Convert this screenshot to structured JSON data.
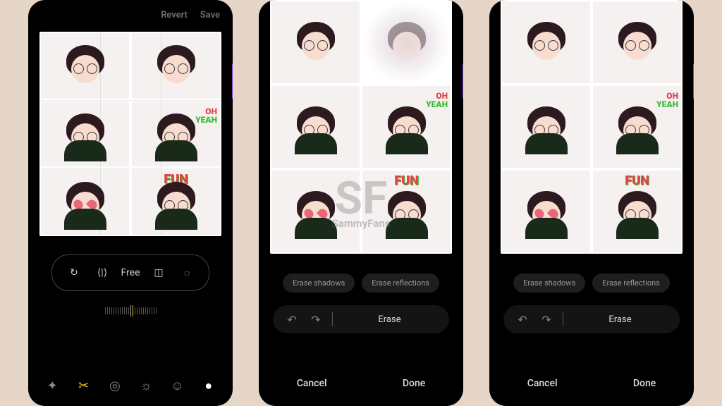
{
  "phone1": {
    "topbar": {
      "revert": "Revert",
      "save": "Save"
    },
    "crop_tools": {
      "rotate": "↻",
      "flip_h": "⟨|⟩",
      "free": "Free",
      "perspective": "◫",
      "shape": "◌"
    },
    "bottom_nav": {
      "auto": "✦",
      "crop": "✂",
      "filter": "◎",
      "brightness": "☼",
      "sticker": "☺",
      "more": "●"
    }
  },
  "phone2": {
    "options": {
      "shadows": "Erase shadows",
      "reflections": "Erase reflections"
    },
    "actions": {
      "undo": "↶",
      "redo": "↷",
      "erase": "Erase"
    },
    "bottom": {
      "cancel": "Cancel",
      "done": "Done"
    }
  },
  "phone3": {
    "options": {
      "shadows": "Erase shadows",
      "reflections": "Erase reflections"
    },
    "actions": {
      "undo": "↶",
      "redo": "↷",
      "erase": "Erase"
    },
    "bottom": {
      "cancel": "Cancel",
      "done": "Done"
    }
  },
  "stickers": {
    "oh": "OH",
    "yeah": "YEAH",
    "fun": "FUN"
  },
  "watermark": {
    "big": "SF",
    "small": "SammyFans"
  }
}
